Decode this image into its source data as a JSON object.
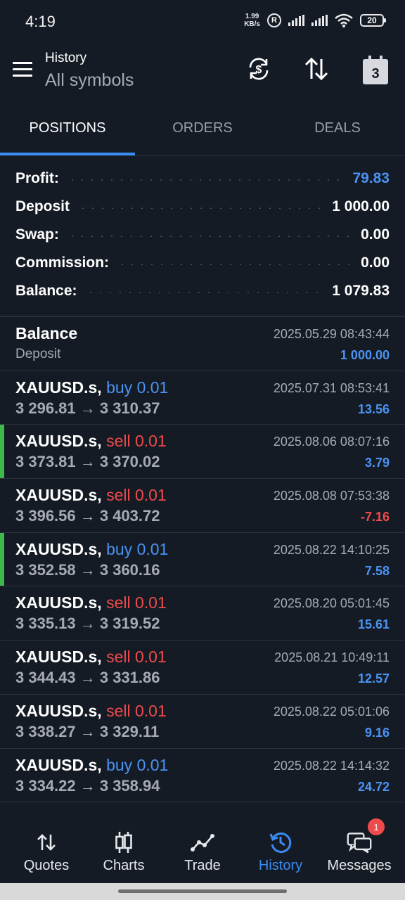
{
  "status_bar": {
    "time": "4:19",
    "net_speed_value": "1.99",
    "net_speed_unit": "KB/s",
    "registered_mark": "R",
    "battery": "20"
  },
  "header": {
    "title": "History",
    "subtitle": "All symbols",
    "calendar_day": "3",
    "icons": [
      "menu-icon",
      "currency-sync-icon",
      "sort-icon",
      "calendar-icon"
    ]
  },
  "tabs": [
    {
      "label": "POSITIONS",
      "active": true
    },
    {
      "label": "ORDERS",
      "active": false
    },
    {
      "label": "DEALS",
      "active": false
    }
  ],
  "summary": {
    "profit": {
      "label": "Profit:",
      "value": "79.83"
    },
    "deposit": {
      "label": "Deposit",
      "value": "1 000.00"
    },
    "swap": {
      "label": "Swap:",
      "value": "0.00"
    },
    "commission": {
      "label": "Commission:",
      "value": "0.00"
    },
    "balance": {
      "label": "Balance:",
      "value": "1 079.83"
    }
  },
  "balance_entry": {
    "title": "Balance",
    "subtitle": "Deposit",
    "time": "2025.05.29 08:43:44",
    "amount": "1 000.00"
  },
  "positions": [
    {
      "symbol": "XAUUSD.s,",
      "direction": "buy 0.01",
      "side": "buy",
      "prices": "3 296.81 → 3 310.37",
      "time": "2025.07.31 08:53:41",
      "profit": "13.56",
      "marked": false
    },
    {
      "symbol": "XAUUSD.s,",
      "direction": "sell 0.01",
      "side": "sell",
      "prices": "3 373.81 → 3 370.02",
      "time": "2025.08.06 08:07:16",
      "profit": "3.79",
      "marked": true
    },
    {
      "symbol": "XAUUSD.s,",
      "direction": "sell 0.01",
      "side": "sell",
      "prices": "3 396.56 → 3 403.72",
      "time": "2025.08.08 07:53:38",
      "profit": "-7.16",
      "marked": false
    },
    {
      "symbol": "XAUUSD.s,",
      "direction": "buy 0.01",
      "side": "buy",
      "prices": "3 352.58 → 3 360.16",
      "time": "2025.08.22 14:10:25",
      "profit": "7.58",
      "marked": true
    },
    {
      "symbol": "XAUUSD.s,",
      "direction": "sell 0.01",
      "side": "sell",
      "prices": "3 335.13 → 3 319.52",
      "time": "2025.08.20 05:01:45",
      "profit": "15.61",
      "marked": false
    },
    {
      "symbol": "XAUUSD.s,",
      "direction": "sell 0.01",
      "side": "sell",
      "prices": "3 344.43 → 3 331.86",
      "time": "2025.08.21 10:49:11",
      "profit": "12.57",
      "marked": false
    },
    {
      "symbol": "XAUUSD.s,",
      "direction": "sell 0.01",
      "side": "sell",
      "prices": "3 338.27 → 3 329.11",
      "time": "2025.08.22 05:01:06",
      "profit": "9.16",
      "marked": false
    },
    {
      "symbol": "XAUUSD.s,",
      "direction": "buy 0.01",
      "side": "buy",
      "prices": "3 334.22 → 3 358.94",
      "time": "2025.08.22 14:14:32",
      "profit": "24.72",
      "marked": false
    }
  ],
  "bottom_nav": [
    {
      "label": "Quotes",
      "icon": "quotes-icon",
      "active": false
    },
    {
      "label": "Charts",
      "icon": "charts-icon",
      "active": false
    },
    {
      "label": "Trade",
      "icon": "trade-icon",
      "active": false
    },
    {
      "label": "History",
      "icon": "history-icon",
      "active": true
    },
    {
      "label": "Messages",
      "icon": "messages-icon",
      "active": false,
      "badge": "1"
    }
  ],
  "colors": {
    "background": "#151b25",
    "accent_blue": "#3a8bf2",
    "positive_blue": "#4b93f3",
    "negative_red": "#ef4b4b",
    "marker_green": "#3db84a"
  }
}
